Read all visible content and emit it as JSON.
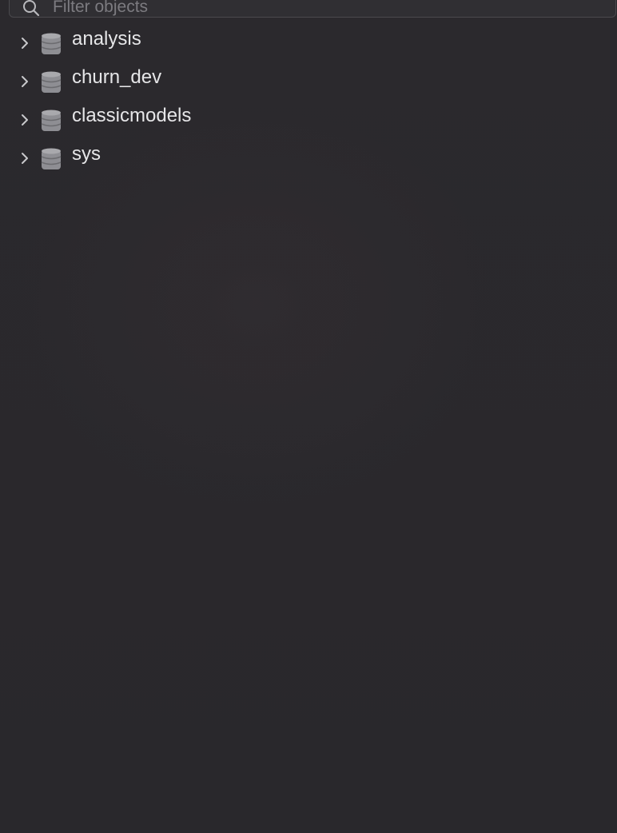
{
  "filter": {
    "placeholder": "Filter objects",
    "value": "",
    "icon": "search-icon"
  },
  "tree": {
    "items": [
      {
        "label": "analysis",
        "icon": "database-icon",
        "expanded": false
      },
      {
        "label": "churn_dev",
        "icon": "database-icon",
        "expanded": false
      },
      {
        "label": "classicmodels",
        "icon": "database-icon",
        "expanded": false
      },
      {
        "label": "sys",
        "icon": "database-icon",
        "expanded": false
      }
    ]
  },
  "colors": {
    "background": "#2a292c",
    "text": "#e6e6e8",
    "placeholder": "#7c7b80",
    "icon": "#8e8e93"
  }
}
